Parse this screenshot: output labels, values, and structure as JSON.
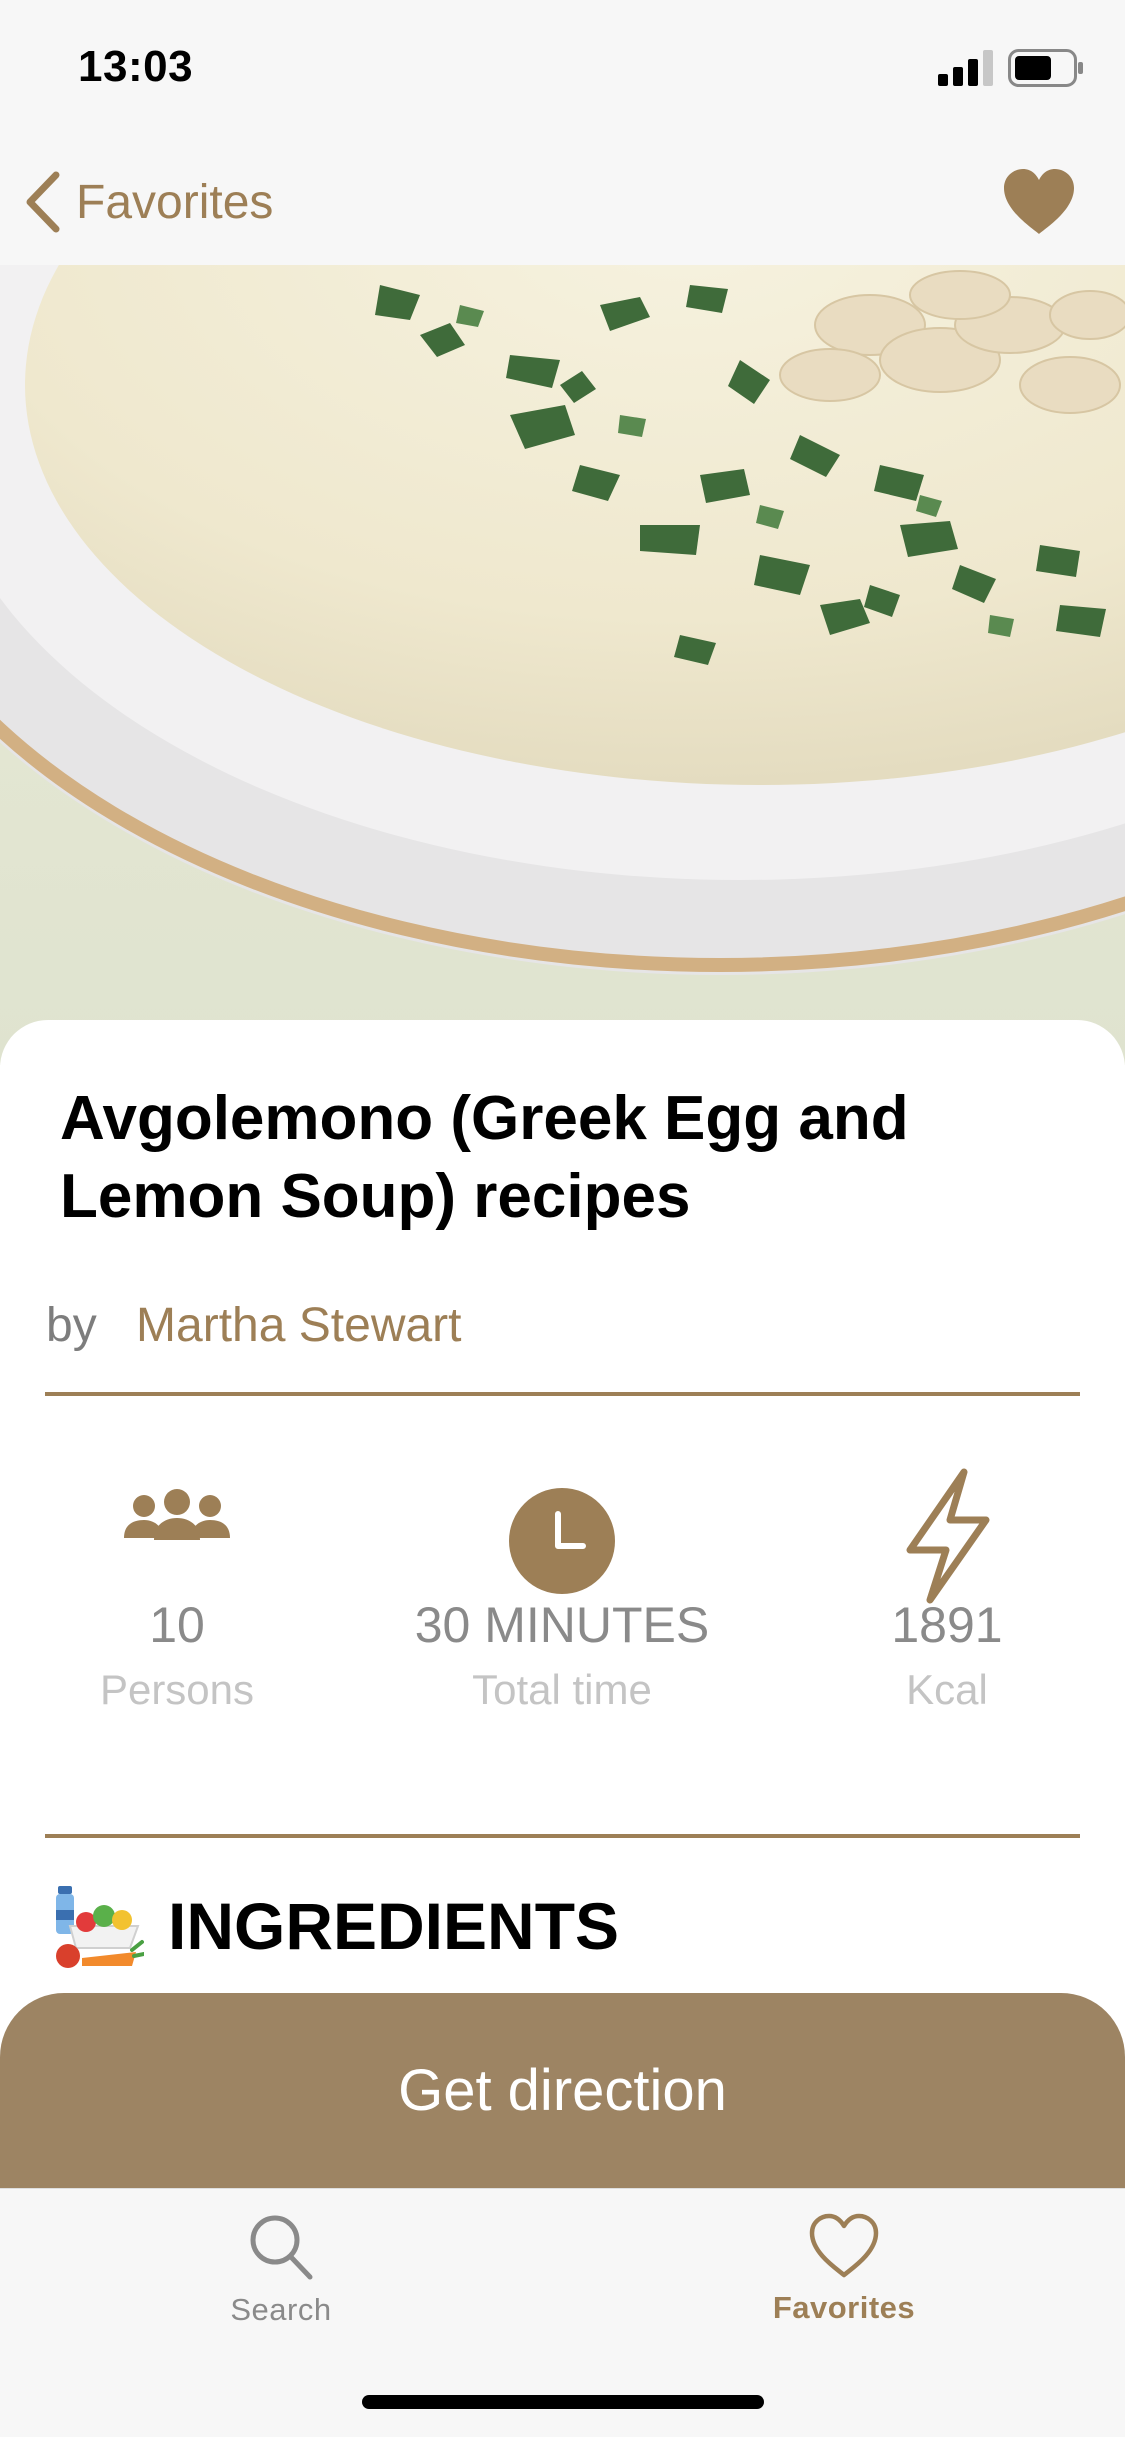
{
  "status_bar": {
    "time": "13:03"
  },
  "nav": {
    "back_label": "Favorites",
    "right_icon": "heart-icon"
  },
  "hero": {
    "image": "avgolemono-soup-photo"
  },
  "recipe": {
    "title": "Avgolemono (Greek Egg and Lemon Soup) recipes",
    "by_label": "by",
    "author": "Martha Stewart"
  },
  "stats": [
    {
      "icon": "people-icon",
      "value": "10",
      "label": "Persons"
    },
    {
      "icon": "clock-icon",
      "value": "30 MINUTES",
      "label": "Total time"
    },
    {
      "icon": "lightning-icon",
      "value": "1891",
      "label": "Kcal"
    }
  ],
  "ingredients": {
    "title": "INGREDIENTS",
    "icon": "groceries-icon"
  },
  "direction_button": {
    "label": "Get direction"
  },
  "tab_bar": {
    "tabs": [
      {
        "label": "Search",
        "icon": "search-icon",
        "active": false
      },
      {
        "label": "Favorites",
        "icon": "heart-outline-icon",
        "active": true
      }
    ]
  },
  "colors": {
    "accent": "#9d7f56",
    "button": "#9d8463",
    "inactive": "#8a8a8a"
  }
}
